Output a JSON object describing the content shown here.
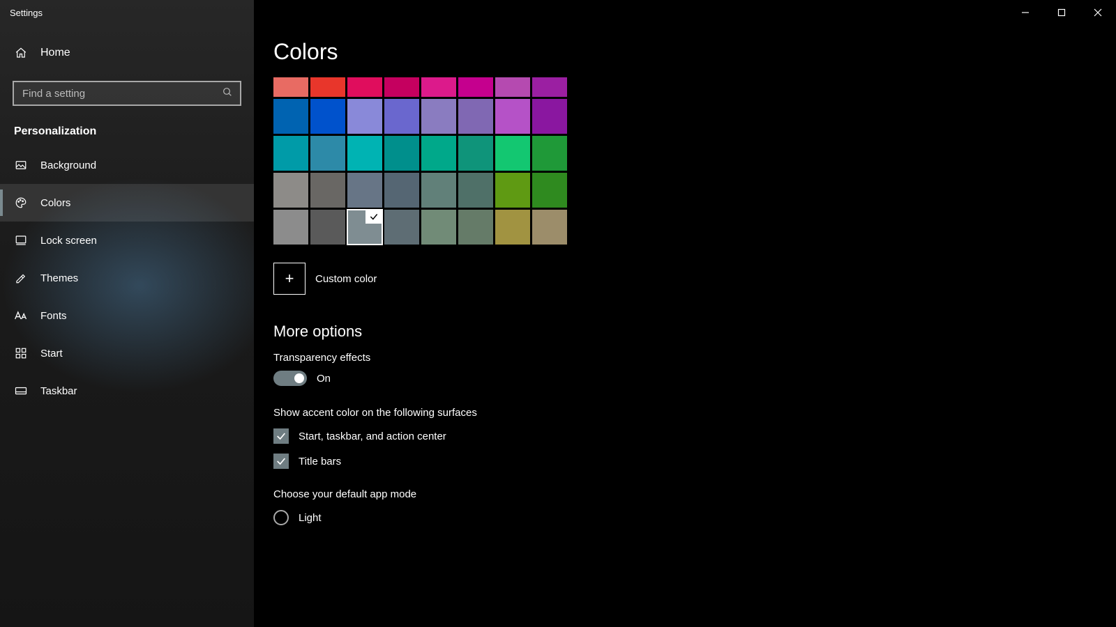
{
  "window": {
    "title": "Settings"
  },
  "sidebar": {
    "home": "Home",
    "search_placeholder": "Find a setting",
    "section": "Personalization",
    "items": [
      {
        "id": "background",
        "label": "Background"
      },
      {
        "id": "colors",
        "label": "Colors",
        "active": true
      },
      {
        "id": "lockscreen",
        "label": "Lock screen"
      },
      {
        "id": "themes",
        "label": "Themes"
      },
      {
        "id": "fonts",
        "label": "Fonts"
      },
      {
        "id": "start",
        "label": "Start"
      },
      {
        "id": "taskbar",
        "label": "Taskbar"
      }
    ]
  },
  "page": {
    "title": "Colors",
    "palette": {
      "row0_height": 28,
      "rows": [
        [
          "#e86b63",
          "#e8362b",
          "#e00d5d",
          "#c5005f",
          "#dc1a8b",
          "#c5008e",
          "#b54ab0",
          "#9b1fa2"
        ],
        [
          "#0063b1",
          "#0052cc",
          "#8989d9",
          "#6a67ce",
          "#8a7cc0",
          "#8068b3",
          "#b552c7",
          "#8a17a0"
        ],
        [
          "#009ba8",
          "#2d8aa8",
          "#00b3b3",
          "#008f8c",
          "#00a88a",
          "#0f947a",
          "#13c771",
          "#1f9938"
        ],
        [
          "#8d8b88",
          "#696764",
          "#677586",
          "#556673",
          "#618079",
          "#4f7068",
          "#5f9a13",
          "#2f8a1f"
        ],
        [
          "#8c8c8c",
          "#5a5a5a",
          "#7f8d92",
          "#5e6d74",
          "#718b77",
          "#657b68",
          "#a19341",
          "#9c8d6a"
        ]
      ],
      "selected": {
        "row": 4,
        "col": 2
      }
    },
    "custom_color": "Custom color",
    "more_options": "More options",
    "transparency": {
      "label": "Transparency effects",
      "state": "On",
      "value": true
    },
    "accent_surfaces": {
      "label": "Show accent color on the following surfaces",
      "options": [
        {
          "id": "start-taskbar-ac",
          "label": "Start, taskbar, and action center",
          "checked": true
        },
        {
          "id": "title-bars",
          "label": "Title bars",
          "checked": true
        }
      ]
    },
    "app_mode": {
      "label": "Choose your default app mode",
      "options": [
        {
          "id": "light",
          "label": "Light",
          "selected": false
        }
      ]
    }
  }
}
